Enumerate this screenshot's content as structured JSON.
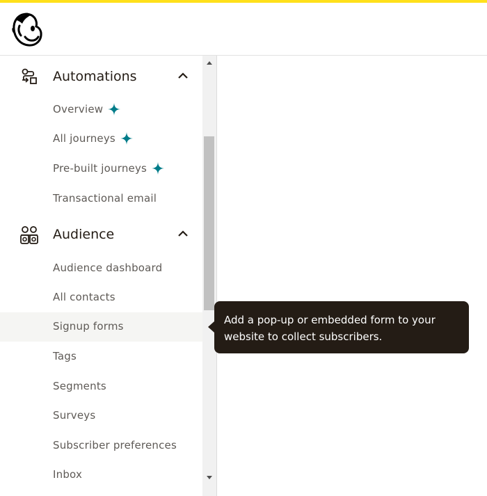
{
  "colors": {
    "accent_bar": "#ffe01b",
    "sparkle": "#007c89",
    "tooltip_bg": "#241c15"
  },
  "icons": {
    "logo": "mailchimp-freddie-logo",
    "automations": "automations-flow-icon",
    "audience": "audience-people-icon",
    "chevron": "chevron-up-icon",
    "sparkle": "sparkle-icon"
  },
  "sidebar": {
    "automations": {
      "label": "Automations",
      "items": [
        {
          "label": "Overview"
        },
        {
          "label": "All journeys"
        },
        {
          "label": "Pre-built journeys"
        },
        {
          "label": "Transactional email"
        }
      ]
    },
    "audience": {
      "label": "Audience",
      "items": [
        {
          "label": "Audience dashboard"
        },
        {
          "label": "All contacts"
        },
        {
          "label": "Signup forms"
        },
        {
          "label": "Tags"
        },
        {
          "label": "Segments"
        },
        {
          "label": "Surveys"
        },
        {
          "label": "Subscriber preferences"
        },
        {
          "label": "Inbox"
        }
      ]
    }
  },
  "tooltip": {
    "line1": "Add a pop-up or embedded form to your",
    "line2": "website to collect subscribers."
  }
}
